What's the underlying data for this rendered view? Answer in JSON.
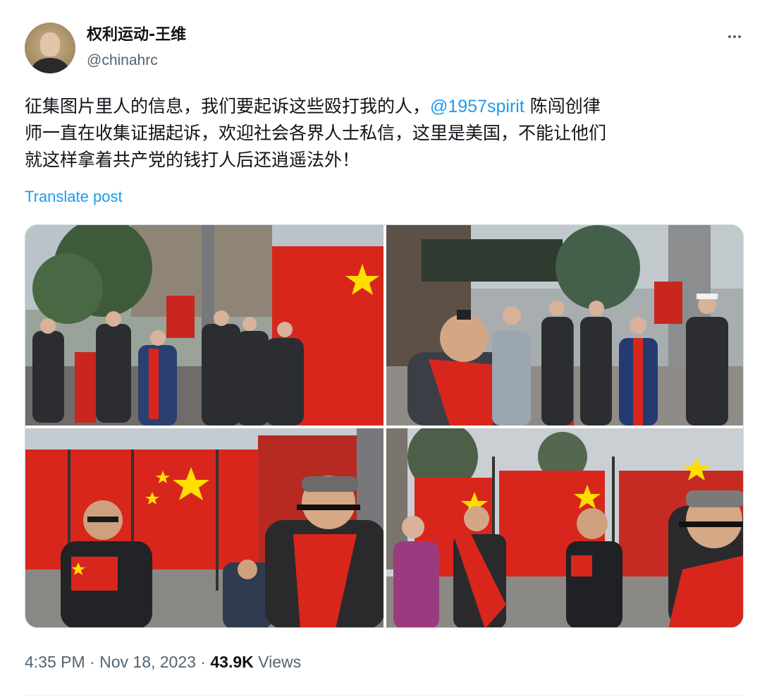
{
  "author": {
    "display_name": "权利运动-王维",
    "handle": "@chinahrc"
  },
  "tweet": {
    "line1_pre": "征集图片里人的信息，我们要起诉这些殴打我的人，",
    "mention": "@1957spirit",
    "line1_post": " 陈闯创律",
    "line2": "师一直在收集证据起诉，欢迎社会各界人士私信，这里是美国，不能让他们",
    "line3": "就这样拿着共产党的钱打人后还逍遥法外！",
    "translate_label": "Translate post"
  },
  "meta": {
    "time": "4:35 PM",
    "separator": " · ",
    "date": "Nov 18, 2023",
    "views_count": "43.9K",
    "views_label": " Views"
  },
  "icons": {
    "more": "more-horizontal-icon"
  },
  "colors": {
    "link": "#1d9bf0",
    "secondary_text": "#536471",
    "flag_red": "#d9261c",
    "flag_star": "#ffde00"
  }
}
